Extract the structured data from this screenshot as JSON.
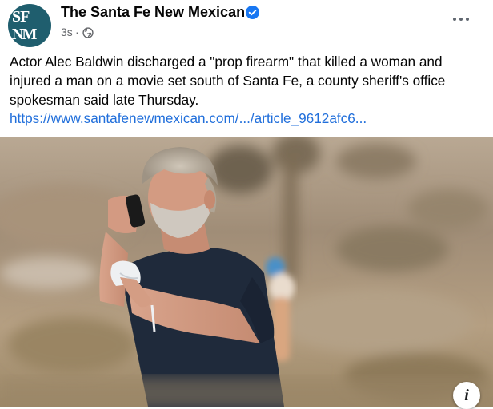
{
  "post": {
    "avatar": {
      "line1": "SF",
      "line2": "NM"
    },
    "page_name": "The Santa Fe New Mexican",
    "timestamp": "3s",
    "separator": "·",
    "audience_icon": "globe-icon",
    "verified_icon": "verified-badge-icon",
    "more_icon": "more-options-icon",
    "text": "Actor Alec Baldwin discharged a \"prop firearm\" that killed a woman and injured a man on a movie set south of Santa Fe, a county sheriff's office spokesman said late Thursday.",
    "link_text": "https://www.santafenewmexican.com/.../article_9612afc6...",
    "info_icon": "info-icon",
    "info_label": "i"
  },
  "colors": {
    "link": "#216fdb",
    "verified": "#1877f2",
    "meta": "#65676b",
    "avatar_bg": "#1f5e6e"
  }
}
